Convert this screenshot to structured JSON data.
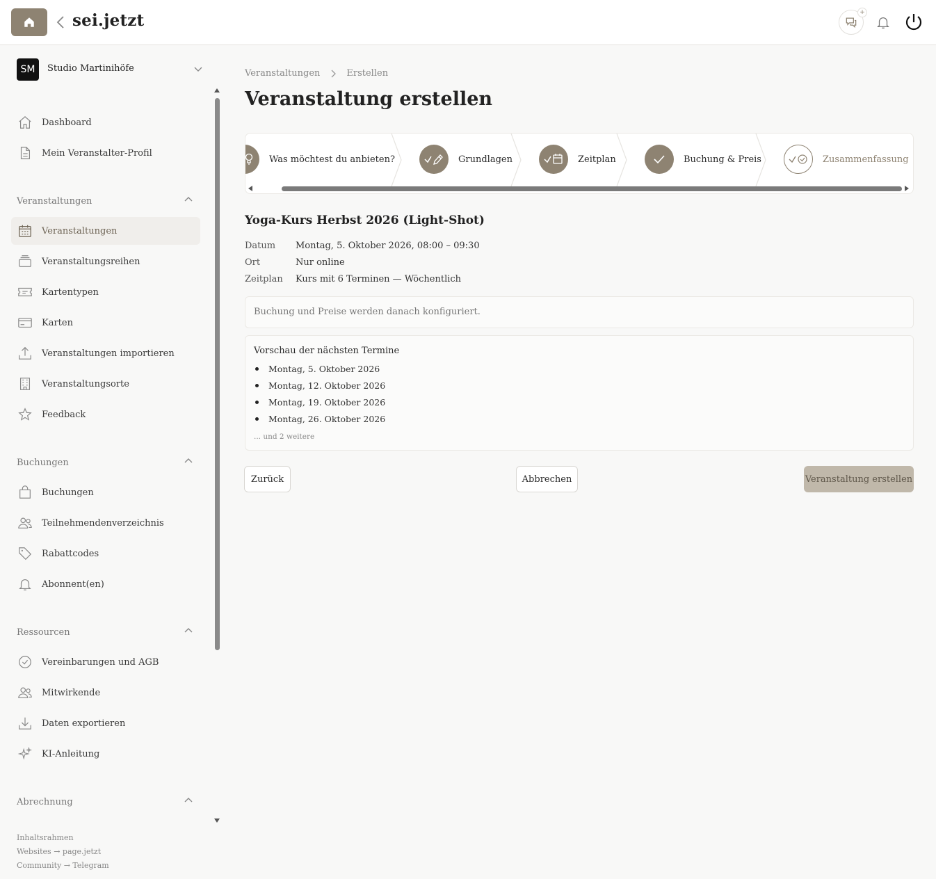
{
  "header": {
    "brand": "sei.jetzt",
    "chat_badge": "+"
  },
  "org": {
    "initials": "SM",
    "name": "Studio Martinihöfe"
  },
  "sidebar": {
    "top_items": [
      {
        "label": "Dashboard",
        "icon": "home-icon"
      },
      {
        "label": "Mein Veranstalter-Profil",
        "icon": "document-icon"
      }
    ],
    "sections": [
      {
        "title": "Veranstaltungen",
        "items": [
          {
            "label": "Veranstaltungen",
            "icon": "calendar-icon",
            "active": true
          },
          {
            "label": "Veranstaltungsreihen",
            "icon": "layers-icon"
          },
          {
            "label": "Kartentypen",
            "icon": "ticket-icon"
          },
          {
            "label": "Karten",
            "icon": "card-icon"
          },
          {
            "label": "Veranstaltungen importieren",
            "icon": "upload-icon"
          },
          {
            "label": "Veranstaltungsorte",
            "icon": "building-icon"
          },
          {
            "label": "Feedback",
            "icon": "star-icon"
          }
        ]
      },
      {
        "title": "Buchungen",
        "items": [
          {
            "label": "Buchungen",
            "icon": "bag-icon"
          },
          {
            "label": "Teilnehmendenverzeichnis",
            "icon": "users-icon"
          },
          {
            "label": "Rabattcodes",
            "icon": "tag-icon"
          },
          {
            "label": "Abonnent(en)",
            "icon": "bell-icon"
          }
        ]
      },
      {
        "title": "Ressourcen",
        "items": [
          {
            "label": "Vereinbarungen und AGB",
            "icon": "check-circle-icon"
          },
          {
            "label": "Mitwirkende",
            "icon": "users-icon"
          },
          {
            "label": "Daten exportieren",
            "icon": "download-icon"
          },
          {
            "label": "KI-Anleitung",
            "icon": "sparkles-icon"
          }
        ]
      },
      {
        "title": "Abrechnung",
        "items": []
      }
    ],
    "footer_links": [
      "Inhaltsrahmen",
      "Websites → page.jetzt",
      "Community → Telegram"
    ]
  },
  "breadcrumb": {
    "parent": "Veranstaltungen",
    "current": "Erstellen"
  },
  "page_title": "Veranstaltung erstellen",
  "steps": [
    {
      "label": "Was möchtest du anbieten?",
      "icon": "lightbulb-icon",
      "done": true
    },
    {
      "label": "Grundlagen",
      "icon": "pencil-icon",
      "done": true
    },
    {
      "label": "Zeitplan",
      "icon": "calendar-icon",
      "done": true
    },
    {
      "label": "Buchung & Preis",
      "icon": "check-icon",
      "done": true
    },
    {
      "label": "Zusammenfassung",
      "icon": "check-circle-icon",
      "done": false
    }
  ],
  "event": {
    "title": "Yoga-Kurs Herbst 2026 (Light-Shot)",
    "rows": [
      {
        "key": "Datum",
        "value": "Montag, 5. Oktober 2026, 08:00 – 09:30"
      },
      {
        "key": "Ort",
        "value": "Nur online"
      },
      {
        "key": "Zeitplan",
        "value": "Kurs mit 6 Terminen — Wöchentlich"
      }
    ]
  },
  "note": "Buchung und Preise werden danach konfiguriert.",
  "preview": {
    "heading": "Vorschau der nächsten Termine",
    "dates": [
      "Montag, 5. Oktober 2026",
      "Montag, 12. Oktober 2026",
      "Montag, 19. Oktober 2026",
      "Montag, 26. Oktober 2026"
    ],
    "more": "... und 2 weitere"
  },
  "buttons": {
    "back": "Zurück",
    "cancel": "Abbrechen",
    "create": "Veranstaltung erstellen"
  },
  "colors": {
    "accent": "#8e8372",
    "primary_button": "#c0b8aa"
  }
}
